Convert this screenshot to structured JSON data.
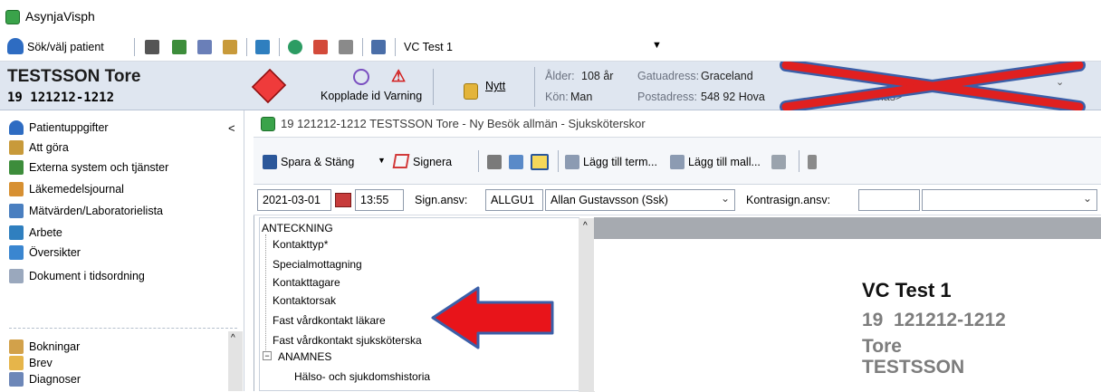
{
  "app": {
    "title": "AsynjaVisph"
  },
  "toolbar": {
    "search_patient": "Sök/välj patient",
    "unit": "VC Test 1"
  },
  "patient": {
    "name": "TESTSSON Tore",
    "id": "19 121212-1212",
    "linked_ids": "Kopplade id",
    "warning": "Varning",
    "new_label": "Nytt",
    "age_label": "Ålder:",
    "age_value": "108 år",
    "sex_label": "Kön:",
    "sex_value": "Man",
    "street_label": "Gatuadress:",
    "street_value": "Graceland",
    "postal_label": "Postadress:",
    "postal_value": "548 92 Hova",
    "hidden_value": "<Saknas>"
  },
  "leftnav": {
    "items": [
      {
        "label": "Patientuppgifter",
        "icon": "person-icon"
      },
      {
        "label": "Att göra",
        "icon": "checklist-icon"
      },
      {
        "label": "Externa system och tjänster",
        "icon": "network-icon"
      },
      {
        "label": "Läkemedelsjournal",
        "icon": "medication-icon"
      },
      {
        "label": "Mätvärden/Laboratorielista",
        "icon": "lab-icon"
      },
      {
        "label": "Arbete",
        "icon": "work-icon"
      },
      {
        "label": "Översikter",
        "icon": "overview-icon"
      },
      {
        "label": "Dokument i tidsordning",
        "icon": "document-icon"
      },
      {
        "label": "Bokningar",
        "icon": "calendar-icon"
      },
      {
        "label": "Brev",
        "icon": "letter-icon"
      },
      {
        "label": "Diagnoser",
        "icon": "diagnosis-icon"
      }
    ],
    "collapse": "<"
  },
  "document": {
    "title": "19 121212-1212 TESTSSON Tore - Ny Besök allmän - Sjuksköterskor",
    "save_close": "Spara & Stäng",
    "sign": "Signera",
    "add_term": "Lägg till term...",
    "add_template": "Lägg till mall...",
    "date": "2021-03-01",
    "time": "13:55",
    "sign_resp_label": "Sign.ansv:",
    "sign_resp_code": "ALLGU1",
    "sign_resp_name": "Allan Gustavsson (Ssk)",
    "cosign_label": "Kontrasign.ansv:"
  },
  "tree": {
    "root": "ANTECKNING",
    "items": [
      "Kontakttyp*",
      "Specialmottagning",
      "Kontakttagare",
      "Kontaktorsak",
      "Fast vårdkontakt läkare",
      "Fast vårdkontakt sjuksköterska"
    ],
    "section2": "ANAMNES",
    "section2_items": [
      "Hälso- och sjukdomshistoria"
    ]
  },
  "preview": {
    "unit": "VC Test 1",
    "id": "19  121212-1212",
    "first_name": "Tore",
    "last_name": "TESTSSON"
  },
  "colors": {
    "accent_blue": "#2b579a",
    "red_annotation": "#e8141a",
    "cross_red": "#e02020",
    "cross_outline": "#3b5fa8"
  }
}
